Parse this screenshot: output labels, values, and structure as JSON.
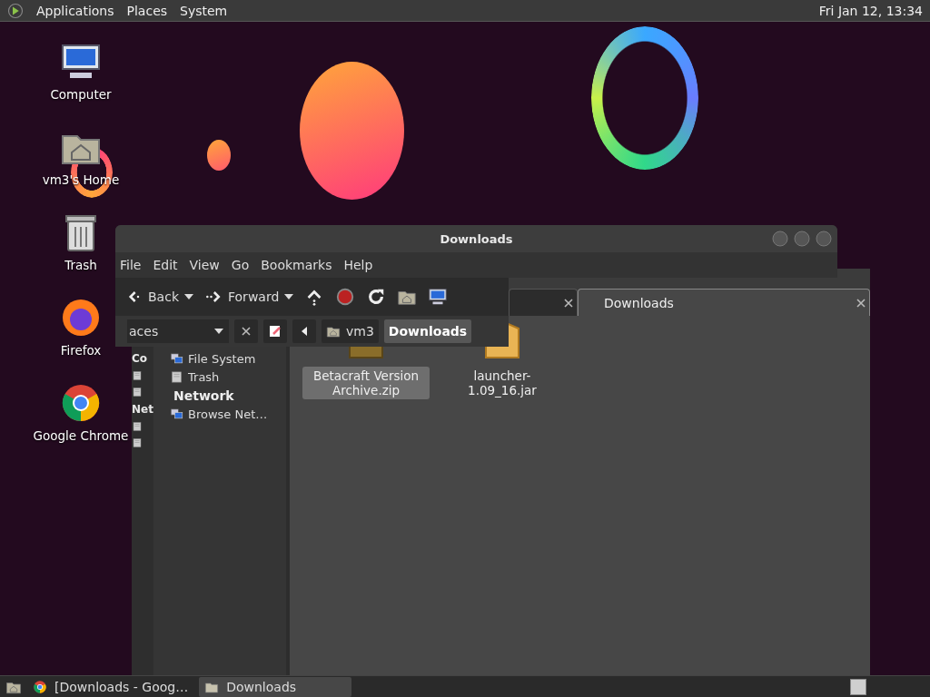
{
  "top_panel": {
    "menus": [
      "Applications",
      "Places",
      "System"
    ],
    "clock": "Fri Jan 12, 13:34"
  },
  "desktop_icons": [
    {
      "label": "Computer",
      "kind": "computer"
    },
    {
      "label": "vm3's Home",
      "kind": "home"
    },
    {
      "label": "Trash",
      "kind": "trash"
    },
    {
      "label": "Firefox",
      "kind": "firefox"
    },
    {
      "label": "Google Chrome",
      "kind": "chrome"
    }
  ],
  "front_window": {
    "title": "Downloads",
    "menu": [
      "File",
      "Edit",
      "View",
      "Go",
      "Bookmarks",
      "Help"
    ],
    "toolbar": [
      {
        "label": "Back",
        "kind": "back"
      },
      {
        "label": "Forward",
        "kind": "forward"
      },
      {
        "kind": "up"
      },
      {
        "kind": "stop"
      },
      {
        "kind": "reload"
      },
      {
        "kind": "home"
      },
      {
        "kind": "computer"
      }
    ],
    "side_pane_selector": "aces",
    "path": [
      {
        "label": "vm3",
        "selected": false
      },
      {
        "label": "Downloads",
        "selected": true
      }
    ]
  },
  "back_window": {
    "tabs": [
      {
        "selected": false
      },
      {
        "label": "Downloads",
        "selected": true
      }
    ],
    "sidebar_fragment": [
      "Co",
      "Net"
    ],
    "sidebar": [
      {
        "label": "File System",
        "kind": "item"
      },
      {
        "label": "Trash",
        "kind": "item"
      },
      {
        "label": "Network",
        "kind": "header"
      },
      {
        "label": "Browse Net…",
        "kind": "item"
      }
    ],
    "files": [
      {
        "name": "Betacraft Version Archive.zip",
        "kind": "archive",
        "selected": true
      },
      {
        "name": "launcher-1.09_16.jar",
        "kind": "jar",
        "selected": false
      }
    ]
  },
  "taskbar": {
    "items": [
      {
        "label": "[Downloads - Goog…",
        "kind": "chrome",
        "selected": false
      },
      {
        "label": "Downloads",
        "kind": "folder",
        "selected": true
      }
    ]
  }
}
